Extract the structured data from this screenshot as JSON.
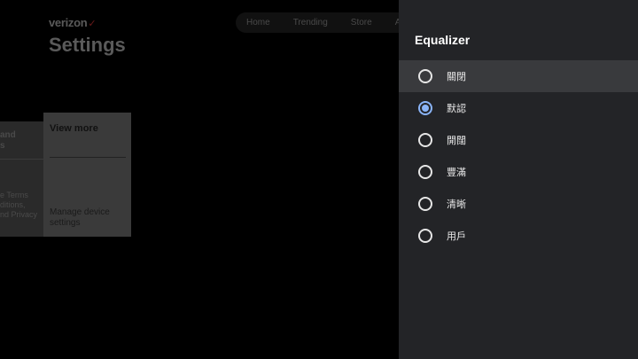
{
  "background": {
    "logo": "verizon",
    "logo_mark": "✓",
    "title": "Settings",
    "nav": [
      "Home",
      "Trending",
      "Store",
      "Ap"
    ],
    "card_left": {
      "top": "and\ns",
      "bottom": "e Terms\nditions,\nnd Privacy"
    },
    "card_main": {
      "title": "View more",
      "desc": "Manage device\nsettings"
    }
  },
  "panel": {
    "title": "Equalizer",
    "options": [
      {
        "label": "關閉",
        "checked": false,
        "focused": true
      },
      {
        "label": "默認",
        "checked": true,
        "focused": false
      },
      {
        "label": "開闊",
        "checked": false,
        "focused": false
      },
      {
        "label": "豐滿",
        "checked": false,
        "focused": false
      },
      {
        "label": "清晰",
        "checked": false,
        "focused": false
      },
      {
        "label": "用戶",
        "checked": false,
        "focused": false
      }
    ],
    "accent": "#8ab4f8"
  }
}
